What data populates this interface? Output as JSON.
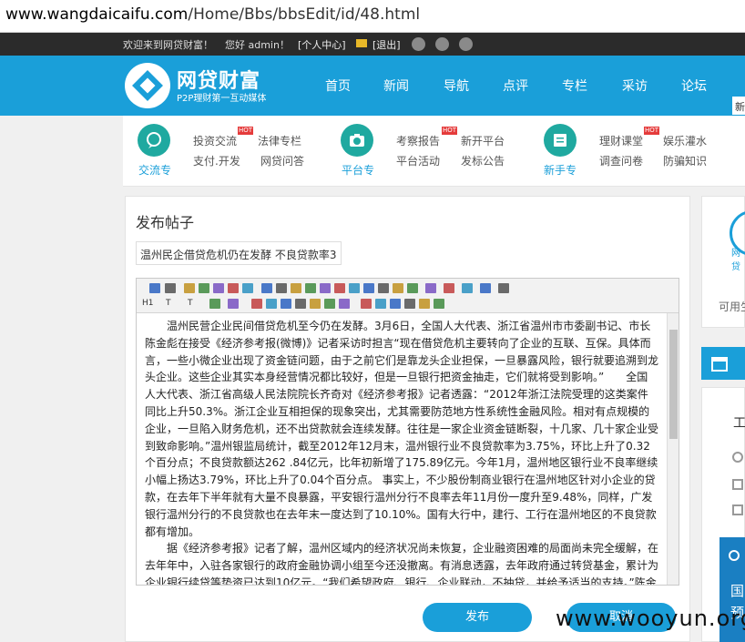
{
  "browser": {
    "url_domain": "www.wangdaicaifu.com",
    "url_path": "/Home/Bbs/bbsEdit/id/48.html"
  },
  "topbar": {
    "welcome": "欢迎来到网贷财富！",
    "greeting": "您好 admin！",
    "user_center": "[个人中心]",
    "logout": "[退出]"
  },
  "header": {
    "brand": "网贷财富",
    "slogan": "P2P理财第一互动媒体",
    "nav": [
      "首页",
      "新闻",
      "导航",
      "点评",
      "专栏",
      "采访",
      "论坛"
    ],
    "new_button": "新"
  },
  "categories": [
    {
      "label": "交流专",
      "links": [
        "投资交流",
        "法律专栏",
        "支付.开发",
        "网贷问答"
      ],
      "hot": "HOT"
    },
    {
      "label": "平台专",
      "links": [
        "考察报告",
        "新开平台",
        "平台活动",
        "发标公告"
      ],
      "hot": "HOT"
    },
    {
      "label": "新手专",
      "links": [
        "理财课堂",
        "娱乐灌水",
        "调查问卷",
        "防骗知识"
      ],
      "hot": "HOT"
    }
  ],
  "post": {
    "page_title": "发布帖子",
    "title_value": "温州民企借贷危机仍在发酵 不良贷款率3",
    "toolbar_text": [
      "H1",
      "T",
      "T"
    ],
    "paragraphs": [
      "温州民营企业民间借贷危机至今仍在发酵。3月6日，全国人大代表、浙江省温州市市委副书记、市长陈金彪在接受《经济参考报(微博)》记者采访时担言“现在借贷危机主要转向了企业的互联、互保。具体而言，一些小微企业出现了资金链问题，由于之前它们是靠龙头企业担保，一旦暴露风险，银行就要追溯到龙头企业。这些企业其实本身经营情况都比较好，但是一旦银行把资金抽走，它们就将受到影响。”　　全国人大代表、浙江省高级人民法院院长齐奇对《经济参考报》记者透露：“2012年浙江法院受理的这类案件同比上升50.3%。浙江企业互相担保的现象突出，尤其需要防范地方性系统性金融风险。相对有点规模的企业，一旦陷入财务危机，还不出贷款就会连续发酵。往往是一家企业资金链断裂，十几家、几十家企业受到致命影响。”温州银监局统计，截至2012年12月末，温州银行业不良贷款率为3.75%，环比上升了0.32个百分点；不良贷款额达262 .84亿元，比年初新增了175.89亿元。今年1月，温州地区银行业不良率继续小幅上扬达3.79%，环比上升了0.04个百分点。 事实上，不少股份制商业银行在温州地区针对小企业的贷款，在去年下半年就有大量不良暴露，平安银行温州分行不良率去年11月份一度升至9.48%，同样，广发银行温州分行的不良贷款也在去年末一度达到了10.10%。国有大行中，建行、工行在温州地区的不良贷款都有增加。",
      "据《经济参考报》记者了解，温州区域内的经济状况尚未恢复，企业融资困难的局面尚未完全缓解，在去年年中，入驻各家银行的政府金融协调小组至今还没撤离。有消息透露，去年政府通过转贷基金，累计为企业银行续贷等垫资已达到10亿元。“我们希望政府、银行、企业联动，不抽贷，并给予适当的支持。”陈金彪说：“我认为晚一年或半年，这些企业就能够化解这些不良贷款，就能够缓解自身资金链的问题。现金流分期还款，也能够解决危机。”"
    ],
    "buttons": [
      "发布",
      "取消"
    ]
  },
  "sidebar": {
    "logo_text": "网贷",
    "hint": "可用生",
    "box_text": [
      "工",
      "国",
      "预"
    ]
  },
  "watermark": "www.wooyun.org",
  "colors": {
    "brand_blue": "#1a9fd9",
    "teal": "#1fa9a0",
    "hot_red": "#e53b3b",
    "dark_bar": "#2b2b2b"
  }
}
